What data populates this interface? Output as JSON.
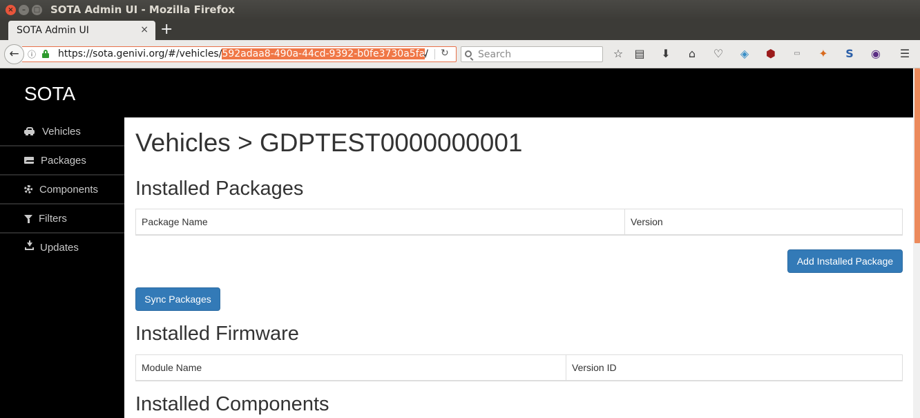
{
  "window": {
    "title": "SOTA Admin UI - Mozilla Firefox",
    "controls": {
      "close": "×",
      "minimize": "–",
      "maximize": "□"
    }
  },
  "browser": {
    "tab": {
      "title": "SOTA Admin UI",
      "close": "×"
    },
    "new_tab": "+",
    "url": {
      "prefix": "https://sota.genivi.org/#/vehicles/",
      "selected": "592adaa8-490a-44cd-9392-b0fe3730a5fa",
      "suffix": "/"
    },
    "search_placeholder": "Search",
    "toolbar_icons": [
      "bookmark-star-icon",
      "reading-list-icon",
      "downloads-icon",
      "home-icon",
      "pocket-icon",
      "extension-translate-icon",
      "ublock-icon",
      "css-icon",
      "extension-fox-icon",
      "extension-s-icon",
      "extension-circle-icon",
      "menu-icon"
    ],
    "accent_color": "#e8714a"
  },
  "app": {
    "brand": "SOTA",
    "sidebar": [
      {
        "label": "Vehicles",
        "icon": "car-icon"
      },
      {
        "label": "Packages",
        "icon": "envelope-icon"
      },
      {
        "label": "Components",
        "icon": "gear-icon"
      },
      {
        "label": "Filters",
        "icon": "filter-icon"
      },
      {
        "label": "Updates",
        "icon": "download-icon"
      }
    ],
    "main": {
      "title": "Vehicles > GDPTEST0000000001",
      "installed_packages": {
        "heading": "Installed Packages",
        "columns": [
          "Package Name",
          "Version"
        ],
        "add_button": "Add Installed Package",
        "sync_button": "Sync Packages"
      },
      "installed_firmware": {
        "heading": "Installed Firmware",
        "columns": [
          "Module Name",
          "Version ID"
        ]
      },
      "installed_components": {
        "heading": "Installed Components"
      }
    },
    "button_color": "#337ab7"
  }
}
